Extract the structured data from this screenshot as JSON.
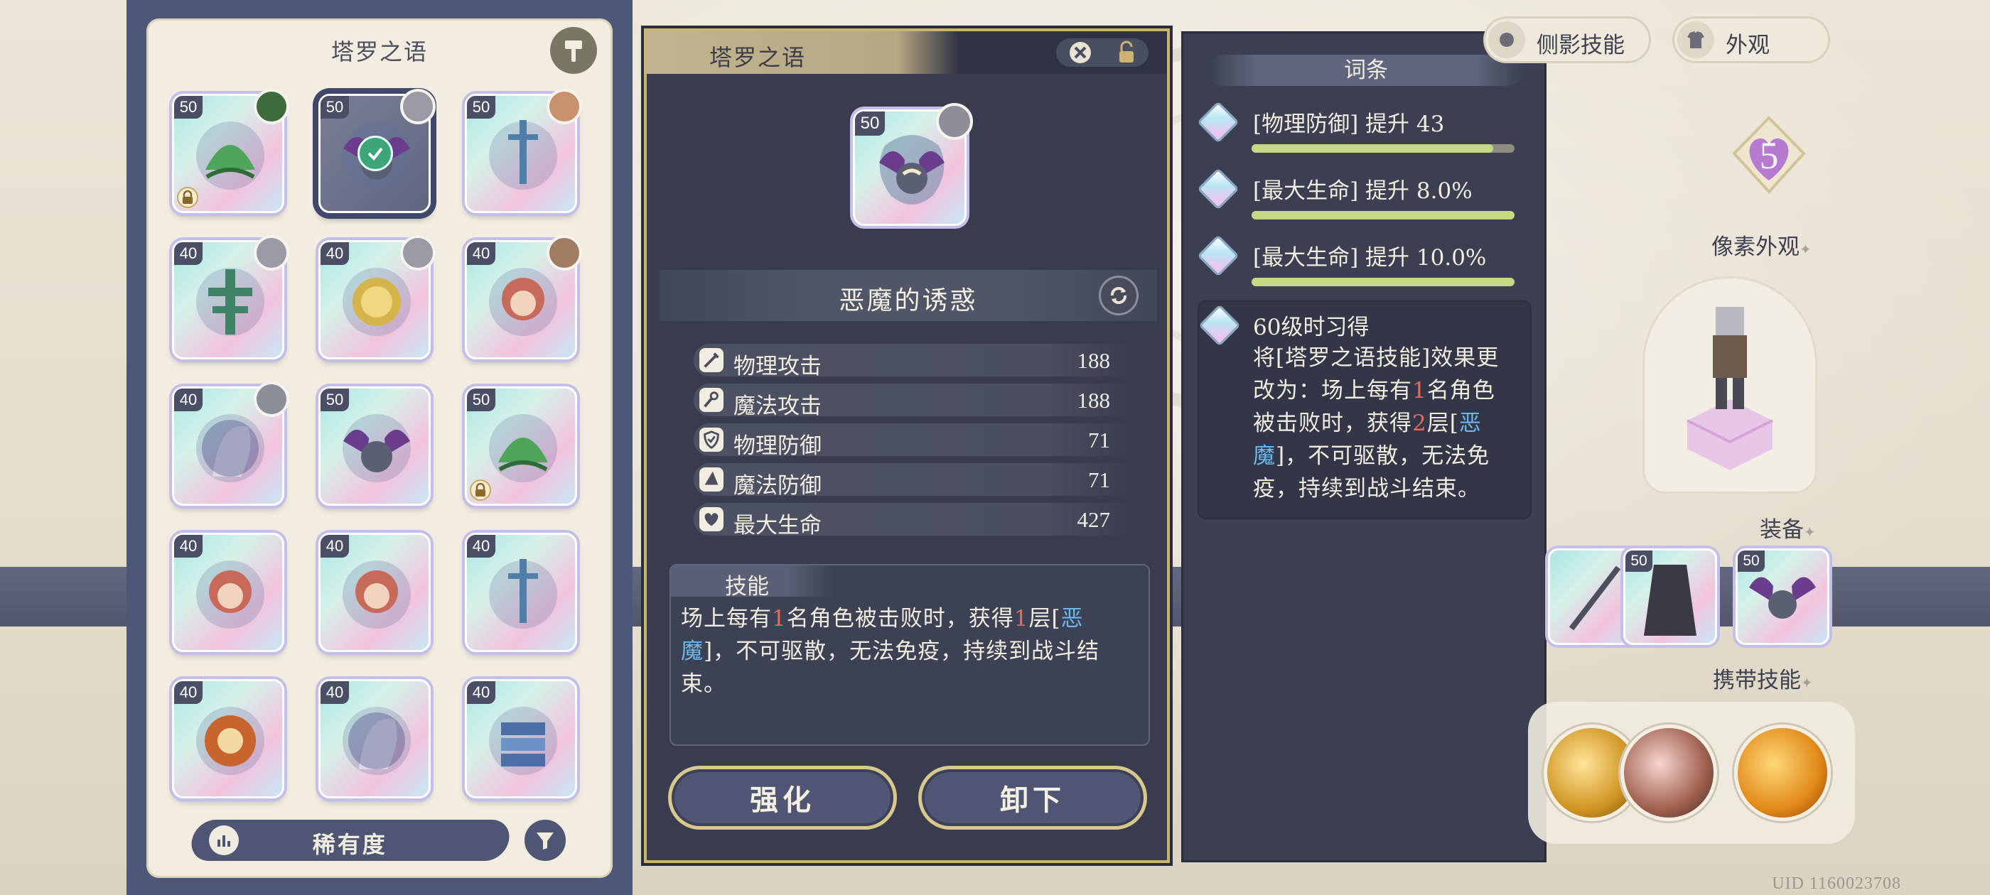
{
  "inventory": {
    "title": "塔罗之语",
    "cards": [
      {
        "level": "50",
        "locked": true,
        "selected": false,
        "art": "green-hat",
        "avatar": "#3e6b3a"
      },
      {
        "level": "50",
        "locked": false,
        "selected": true,
        "art": "demon",
        "avatar": "#9a9aa4"
      },
      {
        "level": "50",
        "locked": false,
        "selected": false,
        "art": "sword",
        "avatar": "#c9926e"
      },
      {
        "level": "40",
        "locked": false,
        "selected": false,
        "art": "cross",
        "avatar": "#9a9aa4"
      },
      {
        "level": "40",
        "locked": false,
        "selected": false,
        "art": "sun",
        "avatar": "#9a9aa4"
      },
      {
        "level": "40",
        "locked": false,
        "selected": false,
        "art": "woman",
        "avatar": "#a07d62"
      },
      {
        "level": "40",
        "locked": false,
        "selected": false,
        "art": "horse",
        "avatar": "#8a8f9a"
      },
      {
        "level": "50",
        "locked": false,
        "selected": false,
        "art": "demon",
        "avatar": ""
      },
      {
        "level": "50",
        "locked": true,
        "selected": false,
        "art": "green-hat",
        "avatar": ""
      },
      {
        "level": "40",
        "locked": false,
        "selected": false,
        "art": "woman",
        "avatar": ""
      },
      {
        "level": "40",
        "locked": false,
        "selected": false,
        "art": "woman",
        "avatar": ""
      },
      {
        "level": "40",
        "locked": false,
        "selected": false,
        "art": "sword",
        "avatar": ""
      },
      {
        "level": "40",
        "locked": false,
        "selected": false,
        "art": "wheel",
        "avatar": ""
      },
      {
        "level": "40",
        "locked": false,
        "selected": false,
        "art": "horse",
        "avatar": ""
      },
      {
        "level": "40",
        "locked": false,
        "selected": false,
        "art": "book",
        "avatar": ""
      }
    ],
    "sort_label": "稀有度"
  },
  "detail": {
    "category": "塔罗之语",
    "item_level": "50",
    "item_name": "恶魔的诱惑",
    "stats": [
      {
        "icon": "sword-icon",
        "label": "物理攻击",
        "value": "188"
      },
      {
        "icon": "wand-icon",
        "label": "魔法攻击",
        "value": "188"
      },
      {
        "icon": "shield-icon",
        "label": "物理防御",
        "value": "71"
      },
      {
        "icon": "wizard-hat-icon",
        "label": "魔法防御",
        "value": "71"
      },
      {
        "icon": "heart-icon",
        "label": "最大生命",
        "value": "427"
      }
    ],
    "skill_label": "技能",
    "skill_text": {
      "p1": "场上每有",
      "n1": "1",
      "p2": "名角色被击败时，获得",
      "n2": "1",
      "p3": "层[",
      "kw": "恶魔",
      "p4": "]，不可驱散，无法免疫，持续到战斗结束。"
    },
    "btn_enhance": "强化",
    "btn_unequip": "卸下"
  },
  "traits": {
    "title": "词条",
    "items": [
      {
        "label": "[物理防御] 提升 43",
        "fill": 0.92
      },
      {
        "label": "[最大生命] 提升 8.0%",
        "fill": 1.0
      },
      {
        "label": "[最大生命] 提升 10.0%",
        "fill": 1.0
      }
    ],
    "unlock_title": "60级时习得",
    "unlock_text": {
      "p1": "将[塔罗之语技能]效果更改为：场上每有",
      "n1": "1",
      "p2": "名角色被击败时，获得",
      "n2": "2",
      "p3": "层[",
      "kw": "恶魔",
      "p4": "]，不可驱散，无法免疫，持续到战斗结束。"
    }
  },
  "right": {
    "tab_skill": "侧影技能",
    "tab_appearance": "外观",
    "star_count": "5",
    "pixel_label": "像素外观",
    "equip_label": "装备",
    "equip_levels": [
      "50",
      "50"
    ],
    "carry_skill_label": "携带技能",
    "uid": "UID 1160023708"
  },
  "colors": {
    "accent_gold": "#cbb46f",
    "highlight_red": "#e86a5a",
    "highlight_blue": "#6ab8ee",
    "panel_dark": "#383c4e"
  }
}
